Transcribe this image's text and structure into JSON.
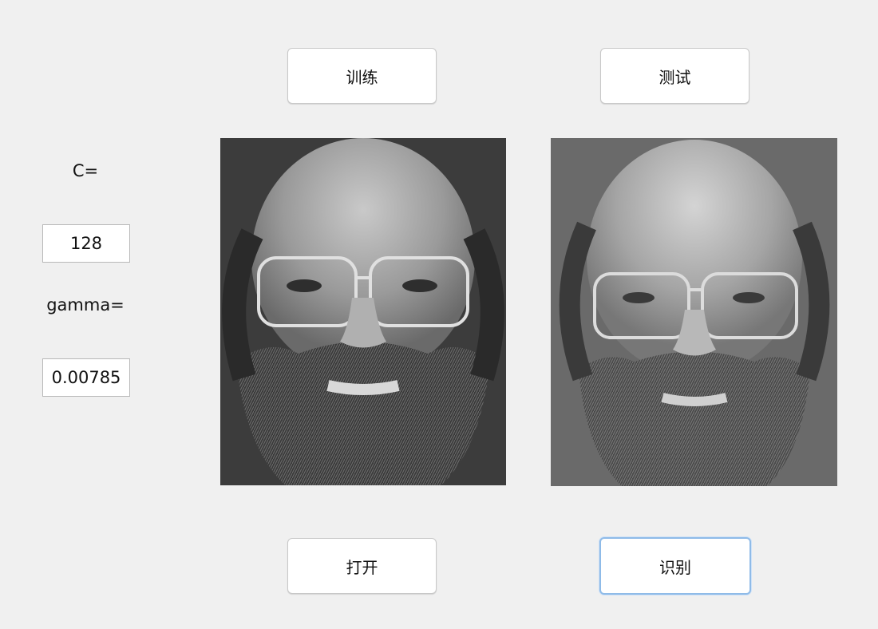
{
  "buttons": {
    "train": "训练",
    "test": "测试",
    "open": "打开",
    "recognize": "识别"
  },
  "params": {
    "c_label": "C=",
    "c_value": "128",
    "gamma_label": "gamma=",
    "gamma_value": "0.00785"
  },
  "images": {
    "input_face": "face-photo",
    "matched_face": "face-photo"
  },
  "colors": {
    "background": "#f0f0f0",
    "focus_ring": "#8fbbe8"
  }
}
